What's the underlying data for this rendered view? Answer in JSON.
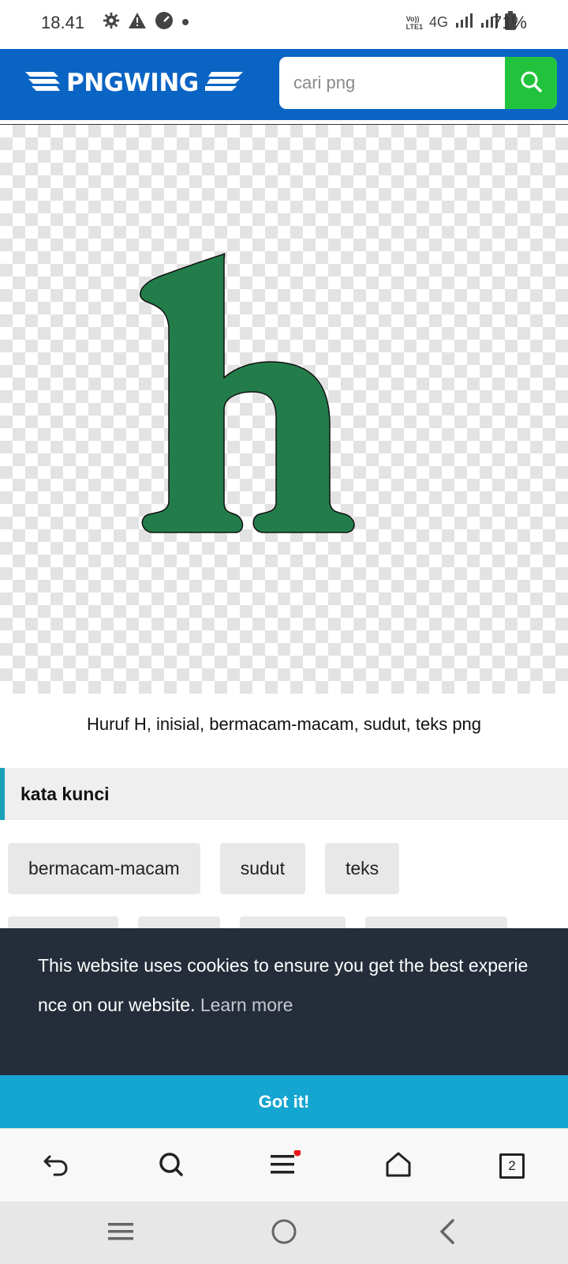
{
  "status_bar": {
    "time": "18.41",
    "network": "4G",
    "volte_line1": "Vo))",
    "volte_line2": "LTE1",
    "battery": "71%"
  },
  "header": {
    "logo_text": "PNGWING",
    "search_placeholder": "cari png",
    "brand_color": "#0a64c4",
    "search_button_color": "#22c33c"
  },
  "image": {
    "letter_color": "#237d4b",
    "caption": "Huruf H, inisial, bermacam-macam, sudut, teks png"
  },
  "keywords": {
    "heading": "kata kunci",
    "chips": [
      "bermacam-macam",
      "sudut",
      "teks"
    ]
  },
  "cookie_banner": {
    "message": "This website uses cookies to ensure you get the best experience on our website.",
    "learn_more": "Learn more",
    "button_label": "Got it!"
  },
  "browser_bar": {
    "tab_count": "2"
  }
}
